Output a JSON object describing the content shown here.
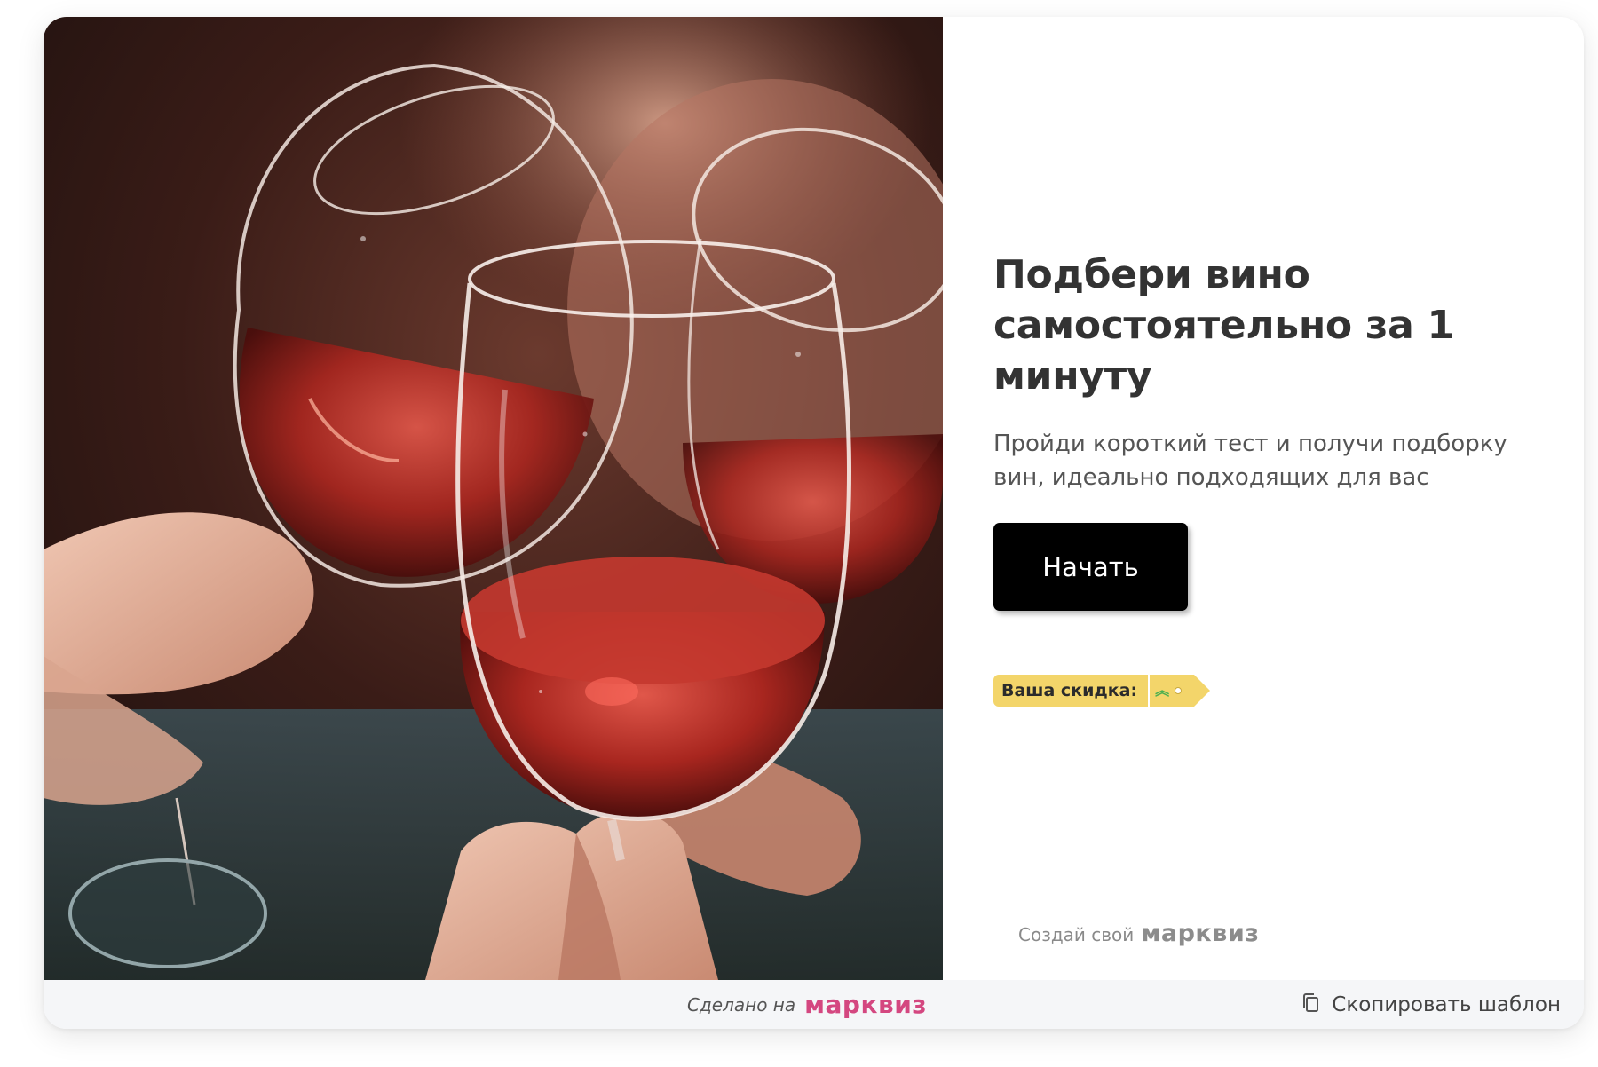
{
  "quiz": {
    "headline": "Подбери вино самостоятельно за 1 минуту",
    "subtitle": "Пройди короткий тест и получи подборку вин, идеально подходящих для вас",
    "start_button": "Начать",
    "discount_label": "Ваша скидка:",
    "create_own_prefix": "Создай свой",
    "create_own_brand": "марквиз"
  },
  "footer": {
    "made_on_prefix": "Сделано на",
    "made_on_brand": "марквиз",
    "copy_template": "Скопировать шаблон"
  },
  "colors": {
    "button_bg": "#000000",
    "discount_tag": "#f3d56a",
    "brand_pink": "#d44780",
    "footer_bg": "#f5f6f8"
  },
  "icons": {
    "discount_progress": "chevrons-up-icon",
    "copy": "copy-icon"
  }
}
